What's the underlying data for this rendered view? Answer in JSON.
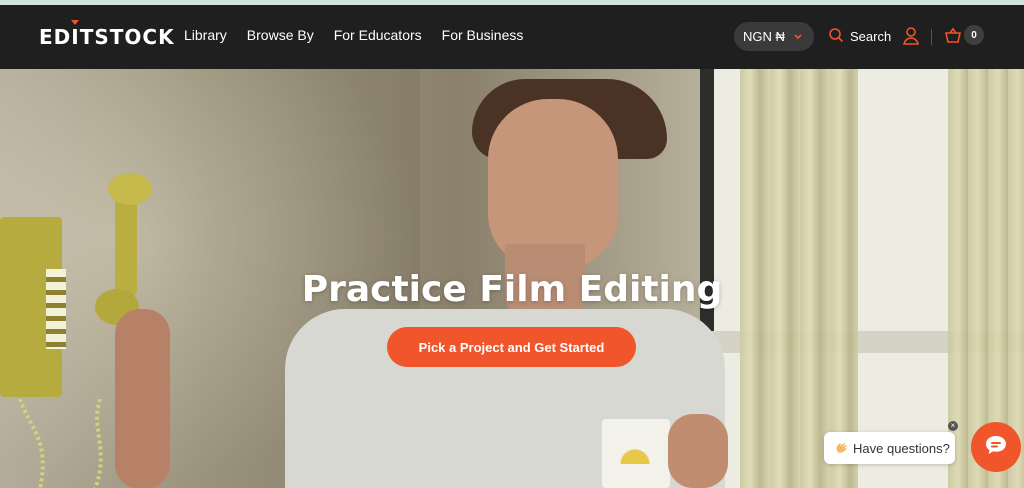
{
  "logo": {
    "pre": "ED",
    "i": "I",
    "post": "TSTOCK"
  },
  "nav": {
    "links": [
      {
        "label": "Library"
      },
      {
        "label": "Browse By"
      },
      {
        "label": "For Educators"
      },
      {
        "label": "For Business"
      }
    ],
    "currency": "NGN ₦",
    "search_label": "Search",
    "cart_count": "0",
    "icons": {
      "search": "search-icon",
      "account": "user-icon",
      "cart": "basket-icon",
      "currency_chevron": "chevron-down-icon"
    }
  },
  "hero": {
    "title": "Practice Film Editing",
    "cta_label": "Pick a Project and Get Started"
  },
  "chat": {
    "prompt": "Have questions?",
    "prompt_icon": "waving-hand-icon",
    "close": "×",
    "button_icon": "chat-icon"
  },
  "colors": {
    "accent": "#f0552b",
    "navbar": "#1f1f1f",
    "pill": "#3a3a3a"
  }
}
